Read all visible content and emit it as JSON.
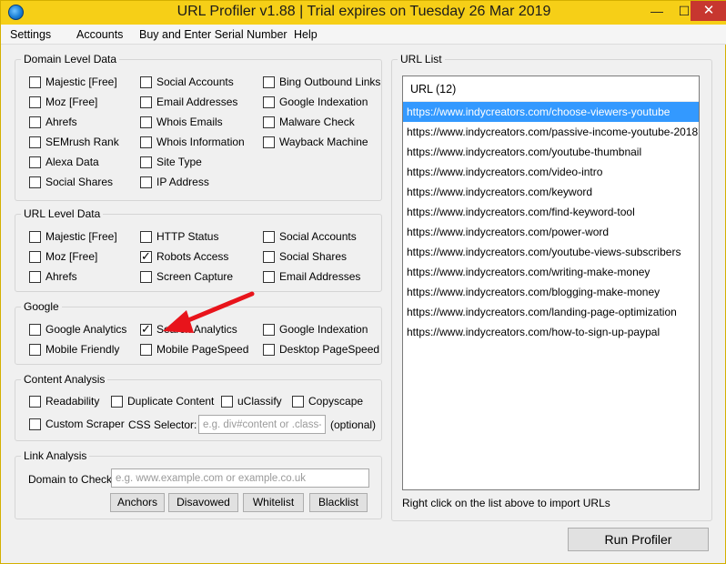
{
  "window": {
    "title": "URL Profiler v1.88 | Trial expires on Tuesday 26 Mar 2019",
    "min": "—",
    "max": "☐",
    "close": "✕"
  },
  "menu": [
    "Settings",
    "Accounts",
    "Buy and Enter Serial Number",
    "Help"
  ],
  "domain_level": {
    "title": "Domain Level Data",
    "items": [
      {
        "label": "Majestic [Free]",
        "checked": false
      },
      {
        "label": "Moz [Free]",
        "checked": false
      },
      {
        "label": "Ahrefs",
        "checked": false
      },
      {
        "label": "SEMrush Rank",
        "checked": false
      },
      {
        "label": "Alexa Data",
        "checked": false
      },
      {
        "label": "Social Shares",
        "checked": false
      },
      {
        "label": "Social Accounts",
        "checked": false
      },
      {
        "label": "Email Addresses",
        "checked": false
      },
      {
        "label": "Whois Emails",
        "checked": false
      },
      {
        "label": "Whois Information",
        "checked": false
      },
      {
        "label": "Site Type",
        "checked": false
      },
      {
        "label": "IP Address",
        "checked": false
      },
      {
        "label": "Bing Outbound Links",
        "checked": false
      },
      {
        "label": "Google Indexation",
        "checked": false
      },
      {
        "label": "Malware Check",
        "checked": false
      },
      {
        "label": "Wayback Machine",
        "checked": false
      }
    ]
  },
  "url_level": {
    "title": "URL Level Data",
    "items": [
      {
        "label": "Majestic [Free]",
        "checked": false
      },
      {
        "label": "Moz [Free]",
        "checked": false
      },
      {
        "label": "Ahrefs",
        "checked": false
      },
      {
        "label": "HTTP Status",
        "checked": false
      },
      {
        "label": "Robots Access",
        "checked": true
      },
      {
        "label": "Screen Capture",
        "checked": false
      },
      {
        "label": "Social Accounts",
        "checked": false
      },
      {
        "label": "Social Shares",
        "checked": false
      },
      {
        "label": "Email Addresses",
        "checked": false
      }
    ]
  },
  "google": {
    "title": "Google",
    "items": [
      {
        "label": "Google Analytics",
        "checked": false
      },
      {
        "label": "Mobile Friendly",
        "checked": false
      },
      {
        "label": "Search Analytics",
        "checked": true
      },
      {
        "label": "Mobile PageSpeed",
        "checked": false
      },
      {
        "label": "Google Indexation",
        "checked": false
      },
      {
        "label": "Desktop PageSpeed",
        "checked": false
      }
    ]
  },
  "content": {
    "title": "Content Analysis",
    "items": [
      {
        "label": "Readability",
        "checked": false
      },
      {
        "label": "Duplicate Content",
        "checked": false
      },
      {
        "label": "uClassify",
        "checked": false
      },
      {
        "label": "Copyscape",
        "checked": false
      },
      {
        "label": "Custom Scraper",
        "checked": false
      }
    ],
    "css_selector_label": "CSS Selector:",
    "css_selector_placeholder": "e.g. div#content or .class-name",
    "optional": "(optional)"
  },
  "link": {
    "title": "Link Analysis",
    "domain_label": "Domain to Check:",
    "domain_placeholder": "e.g. www.example.com or example.co.uk",
    "buttons": [
      "Anchors",
      "Disavowed",
      "Whitelist",
      "Blacklist"
    ]
  },
  "url_list": {
    "title": "URL List",
    "header": "URL (12)",
    "urls": [
      "https://www.indycreators.com/choose-viewers-youtube",
      "https://www.indycreators.com/passive-income-youtube-2018",
      "https://www.indycreators.com/youtube-thumbnail",
      "https://www.indycreators.com/video-intro",
      "https://www.indycreators.com/keyword",
      "https://www.indycreators.com/find-keyword-tool",
      "https://www.indycreators.com/power-word",
      "https://www.indycreators.com/youtube-views-subscribers",
      "https://www.indycreators.com/writing-make-money",
      "https://www.indycreators.com/blogging-make-money",
      "https://www.indycreators.com/landing-page-optimization",
      "https://www.indycreators.com/how-to-sign-up-paypal"
    ],
    "selected_index": 0,
    "hint": "Right click on the list above to import URLs"
  },
  "run_label": "Run Profiler",
  "colors": {
    "titlebar": "#f6cf17",
    "selection": "#3399ff",
    "arrow": "#e8141b",
    "close": "#c7372f"
  }
}
